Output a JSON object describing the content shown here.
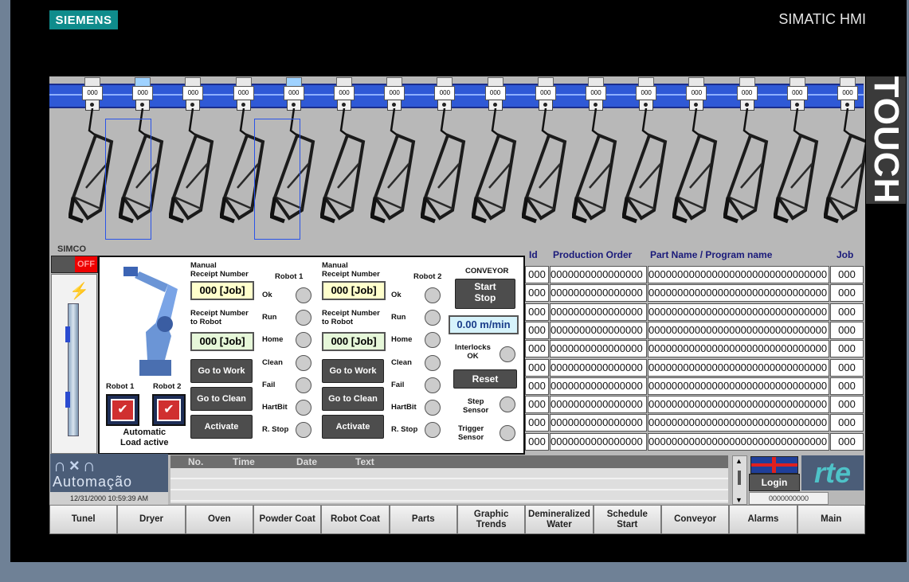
{
  "brand": {
    "left": "SIEMENS",
    "right": "SIMATIC HMI",
    "side": "TOUCH"
  },
  "conveyor": {
    "hooks": [
      "000",
      "000",
      "000",
      "000",
      "000",
      "000",
      "000",
      "000",
      "000",
      "000",
      "000",
      "000",
      "000",
      "000",
      "000",
      "000"
    ]
  },
  "simco": {
    "label": "SIMCO",
    "switch": "OFF"
  },
  "robot_panel": {
    "robot1_label": "Robot 1",
    "robot2_label": "Robot 2",
    "auto_load": "Automatic\nLoad active",
    "col1": {
      "manual_label": "Manual\nReceipt Number",
      "manual_value": "000 [Job]",
      "receipt_label": "Receipt Number\nto Robot",
      "receipt_value": "000 [Job]",
      "go_work": "Go to Work",
      "go_clean": "Go to Clean",
      "activate": "Activate"
    },
    "col2": {
      "manual_label": "Manual\nReceipt Number",
      "manual_value": "000 [Job]",
      "receipt_label": "Receipt Number\nto Robot",
      "receipt_value": "000 [Job]",
      "go_work": "Go to Work",
      "go_clean": "Go to Clean",
      "activate": "Activate"
    },
    "status1_title": "Robot 1",
    "status2_title": "Robot 2",
    "status_labels": [
      "Ok",
      "Run",
      "Home",
      "Clean",
      "Fail",
      "HartBit",
      "R. Stop"
    ],
    "conveyor_title": "CONVEYOR",
    "start_stop": "Start\nStop",
    "speed": "0.00 m/min",
    "interlocks": "Interlocks\nOK",
    "reset": "Reset",
    "step_sensor": "Step\nSensor",
    "trigger_sensor": "Trigger\nSensor"
  },
  "table": {
    "headers": [
      "Id",
      "Production Order",
      "Part Name / Program name",
      "Job"
    ],
    "rows": [
      [
        "000",
        "0000000000000000",
        "0000000000000000000000000000000",
        "000"
      ],
      [
        "000",
        "0000000000000000",
        "0000000000000000000000000000000",
        "000"
      ],
      [
        "000",
        "0000000000000000",
        "0000000000000000000000000000000",
        "000"
      ],
      [
        "000",
        "0000000000000000",
        "0000000000000000000000000000000",
        "000"
      ],
      [
        "000",
        "0000000000000000",
        "0000000000000000000000000000000",
        "000"
      ],
      [
        "000",
        "0000000000000000",
        "0000000000000000000000000000000",
        "000"
      ],
      [
        "000",
        "0000000000000000",
        "0000000000000000000000000000000",
        "000"
      ],
      [
        "000",
        "0000000000000000",
        "0000000000000000000000000000000",
        "000"
      ],
      [
        "000",
        "0000000000000000",
        "0000000000000000000000000000000",
        "000"
      ],
      [
        "000",
        "0000000000000000",
        "0000000000000000000000000000000",
        "000"
      ]
    ]
  },
  "footer": {
    "logo_text": "Automação",
    "datetime": "12/31/2000 10:59:39 AM",
    "alarm_cols": [
      "No.",
      "Time",
      "Date",
      "Text"
    ],
    "login": "Login",
    "user_field": "0000000000",
    "rte": "rte"
  },
  "nav": [
    "Tunel",
    "Dryer",
    "Oven",
    "Powder Coat",
    "Robot Coat",
    "Parts",
    "Graphic\nTrends",
    "Demineralized\nWater",
    "Schedule\nStart",
    "Conveyor",
    "Alarms",
    "Main"
  ]
}
